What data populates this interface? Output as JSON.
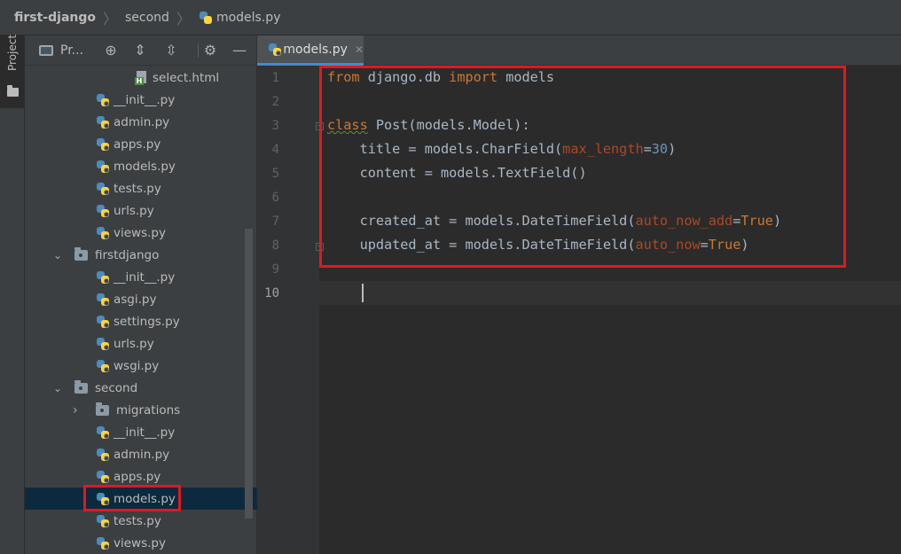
{
  "breadcrumb": {
    "project": "first-django",
    "folder": "second",
    "file": "models.py"
  },
  "side_tool": {
    "project_tab_label": "Project"
  },
  "project_panel": {
    "title": "Pr...",
    "header_icons": [
      "locate-icon",
      "expand-all-icon",
      "collapse-all-icon",
      "gear-icon",
      "minimize-icon"
    ]
  },
  "tree": [
    {
      "label": "select.html",
      "type": "html"
    },
    {
      "label": "__init__.py",
      "type": "py"
    },
    {
      "label": "admin.py",
      "type": "py"
    },
    {
      "label": "apps.py",
      "type": "py"
    },
    {
      "label": "models.py",
      "type": "py"
    },
    {
      "label": "tests.py",
      "type": "py"
    },
    {
      "label": "urls.py",
      "type": "py"
    },
    {
      "label": "views.py",
      "type": "py"
    },
    {
      "label": "firstdjango",
      "type": "folder",
      "expanded": true
    },
    {
      "label": "__init__.py",
      "type": "py"
    },
    {
      "label": "asgi.py",
      "type": "py"
    },
    {
      "label": "settings.py",
      "type": "py"
    },
    {
      "label": "urls.py",
      "type": "py"
    },
    {
      "label": "wsgi.py",
      "type": "py"
    },
    {
      "label": "second",
      "type": "folder",
      "expanded": true
    },
    {
      "label": "migrations",
      "type": "folder",
      "expanded": false
    },
    {
      "label": "__init__.py",
      "type": "py"
    },
    {
      "label": "admin.py",
      "type": "py"
    },
    {
      "label": "apps.py",
      "type": "py"
    },
    {
      "label": "models.py",
      "type": "py",
      "selected": true
    },
    {
      "label": "tests.py",
      "type": "py"
    },
    {
      "label": "views.py",
      "type": "py"
    }
  ],
  "editor": {
    "tab_label": "models.py",
    "line_numbers": [
      "1",
      "2",
      "3",
      "4",
      "5",
      "6",
      "7",
      "8",
      "9",
      "10"
    ],
    "current_line": "10",
    "code": {
      "l1": {
        "kw1": "from",
        "t1": " django.db ",
        "kw2": "import",
        "t2": " models"
      },
      "l3": {
        "kw": "class",
        "t1": " Post(models.Model):"
      },
      "l4": {
        "t1": "    title = models.CharField(",
        "p1": "max_length",
        "t2": "=",
        "n1": "30",
        "t3": ")"
      },
      "l5": {
        "t1": "    content = models.TextField()"
      },
      "l7": {
        "t1": "    created_at = models.DateTimeField(",
        "p1": "auto_now_add",
        "t2": "=",
        "k1": "True",
        "t3": ")"
      },
      "l8": {
        "t1": "    updated_at = models.DateTimeField(",
        "p1": "auto_now",
        "t2": "=",
        "k1": "True",
        "t3": ")"
      }
    }
  },
  "colors": {
    "highlight_box": "#e0191f",
    "keyword": "#cc7832",
    "parameter": "#aa4926",
    "number": "#6897bb",
    "selection": "#0d293e"
  }
}
